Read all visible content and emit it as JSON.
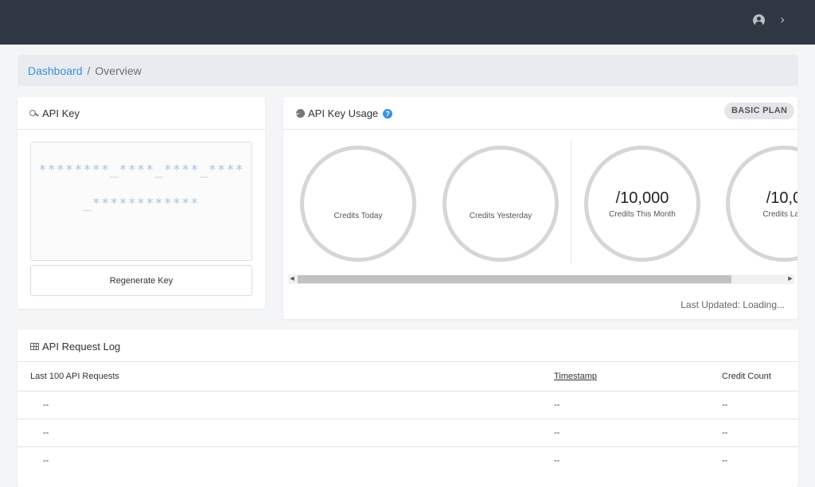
{
  "header": {
    "user_icon": "user-circle-icon",
    "chevron_icon": "chevron-right-icon"
  },
  "breadcrumb": {
    "link": "Dashboard",
    "separator": "/",
    "current": "Overview"
  },
  "api_key": {
    "title": "API Key",
    "icon": "key-icon",
    "masked_key": "********_****_****_****_************",
    "regenerate_label": "Regenerate Key"
  },
  "usage": {
    "title": "API Key Usage",
    "help_icon": "?",
    "plan_badge": "BASIC PLAN",
    "gauges": [
      {
        "value": "",
        "label": "Credits Today"
      },
      {
        "value": "",
        "label": "Credits Yesterday"
      },
      {
        "value": "/10,000",
        "label": "Credits This Month"
      },
      {
        "value": "/10,0",
        "label": "Credits Last"
      }
    ],
    "last_updated": "Last Updated: Loading..."
  },
  "request_log": {
    "title": "API Request Log",
    "columns": [
      "Last 100 API Requests",
      "Timestamp",
      "Credit Count"
    ],
    "rows": [
      [
        "--",
        "--",
        "--"
      ],
      [
        "--",
        "--",
        "--"
      ],
      [
        "--",
        "--",
        "--"
      ]
    ]
  },
  "colors": {
    "topbar": "#2f3742",
    "link": "#3f8fdb",
    "help": "#3b8fe0",
    "gauge_ring": "#d6d6d6"
  }
}
